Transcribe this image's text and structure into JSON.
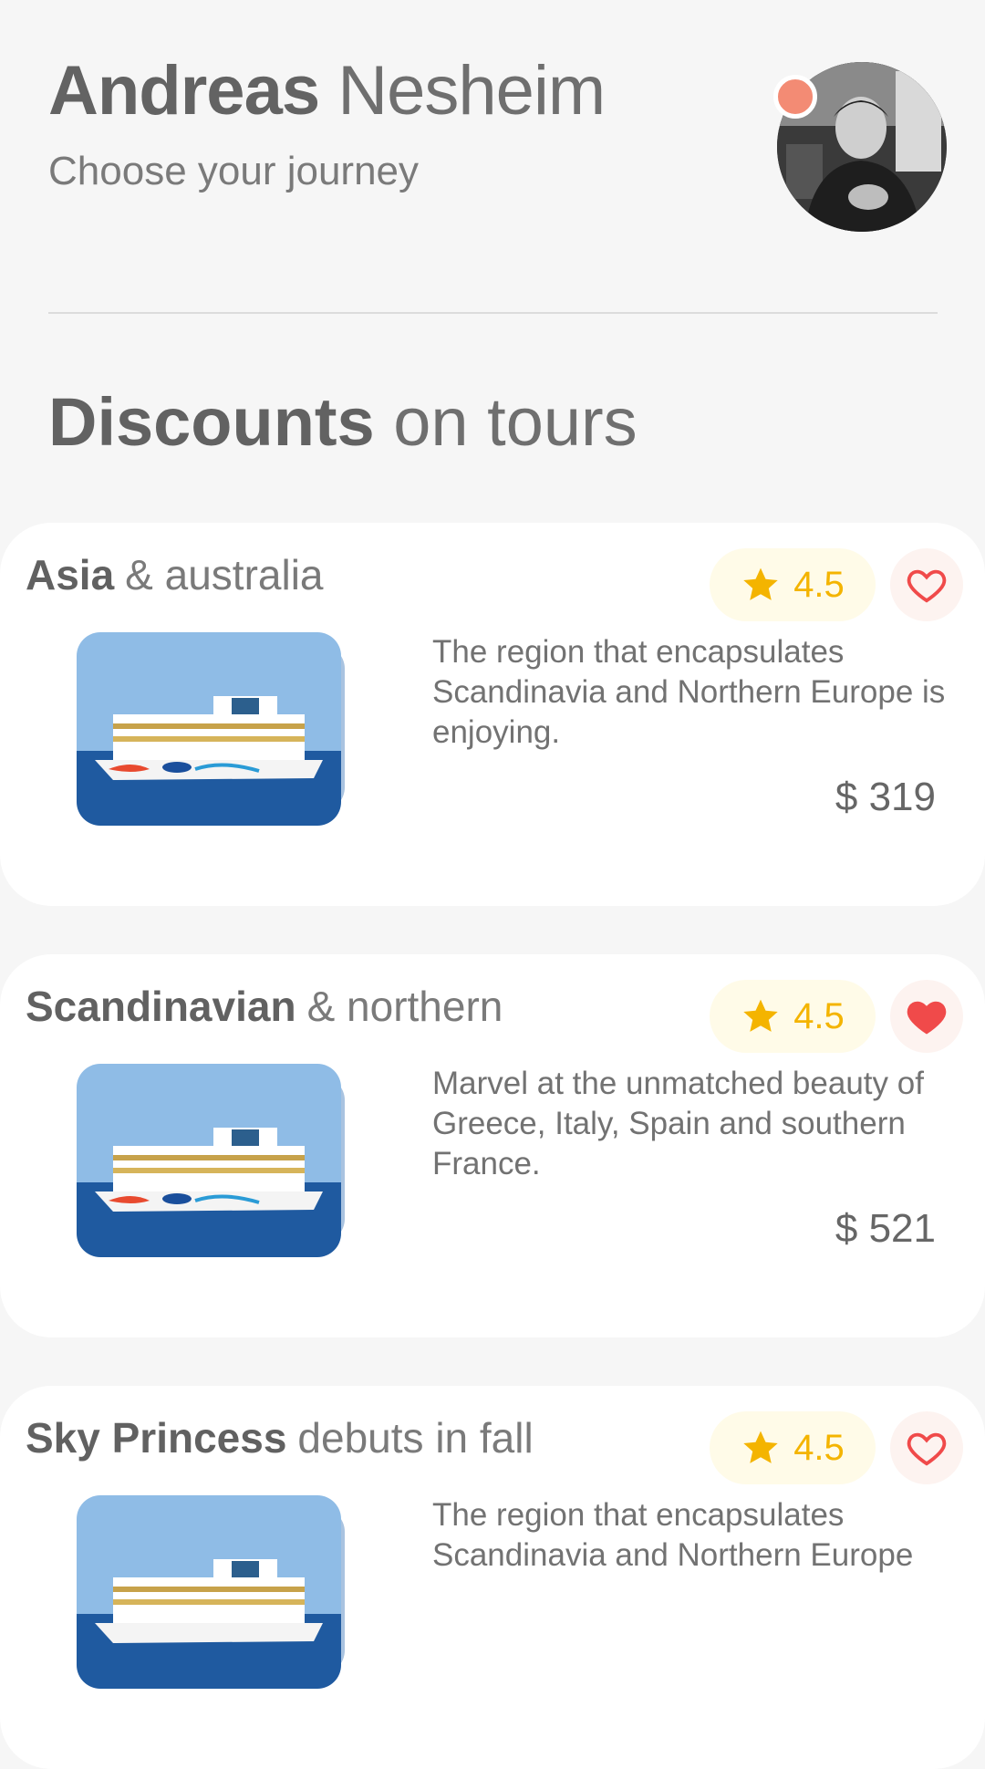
{
  "user": {
    "first_name": "Andreas",
    "last_name": "Nesheim",
    "subtitle": "Choose your journey",
    "status_color": "#f38b74"
  },
  "section": {
    "title_bold": "Discounts",
    "title_light": "on tours"
  },
  "tours": [
    {
      "title_bold": "Asia",
      "title_light": "& australia",
      "rating": "4.5",
      "favorite": false,
      "description": "The region that encapsulates Scandinavia and Northern Europe is enjoying.",
      "price": "$ 319"
    },
    {
      "title_bold": "Scandinavian",
      "title_light": "& northern",
      "rating": "4.5",
      "favorite": true,
      "description": "Marvel at the unmatched beauty of Greece, Italy, Spain and southern France.",
      "price": "$ 521"
    },
    {
      "title_bold": "Sky Princess",
      "title_light": "debuts in fall",
      "rating": "4.5",
      "favorite": false,
      "description": "The region that encapsulates Scandinavia and Northern Europe",
      "price": ""
    }
  ],
  "colors": {
    "rating": "#f4b400",
    "heart": "#f04a4a"
  },
  "icons": {
    "star": "star-icon",
    "heart": "heart-icon"
  }
}
